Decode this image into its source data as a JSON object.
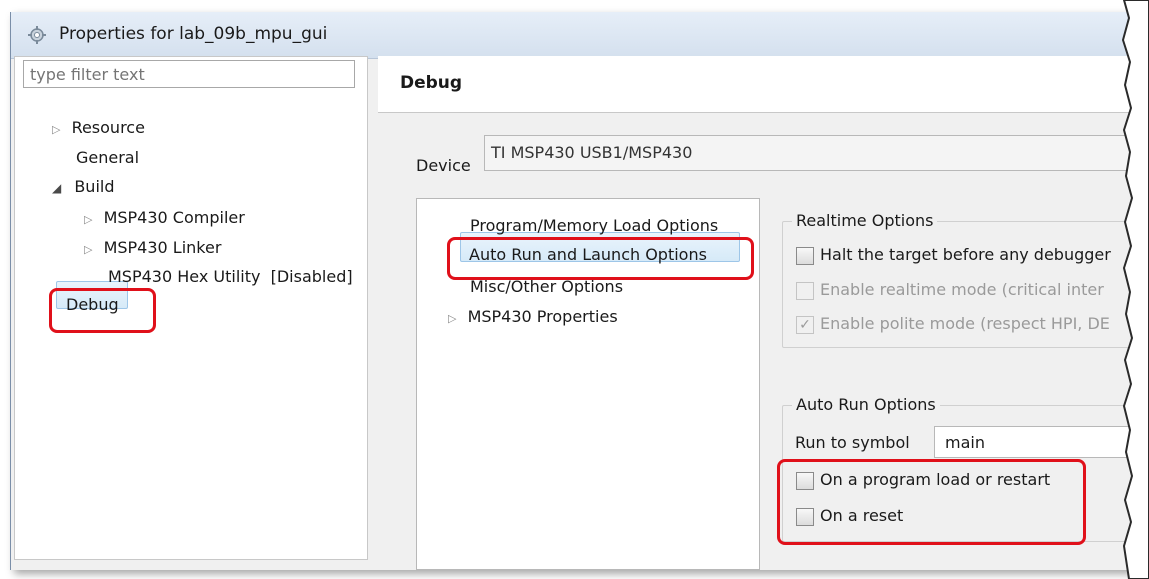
{
  "window": {
    "title": "Properties for lab_09b_mpu_gui"
  },
  "left_pane": {
    "filter_placeholder": "type filter text",
    "tree": [
      {
        "label": "Resource",
        "expander": "▷"
      },
      {
        "label": "General",
        "expander": ""
      },
      {
        "label": "Build",
        "expander": "◢"
      },
      {
        "label": "MSP430 Compiler",
        "expander": "▷"
      },
      {
        "label": "MSP430 Linker",
        "expander": "▷"
      },
      {
        "label": "MSP430 Hex Utility  [Disabled]",
        "expander": ""
      },
      {
        "label": "Debug",
        "expander": "",
        "selected": true
      }
    ]
  },
  "right_pane": {
    "header_title": "Debug",
    "device_label": "Device",
    "device_value": "TI MSP430 USB1/MSP430",
    "options_tree": [
      {
        "label": "Program/Memory Load Options",
        "expander": ""
      },
      {
        "label": "Auto Run and Launch Options",
        "expander": "",
        "selected": true
      },
      {
        "label": "Misc/Other Options",
        "expander": ""
      },
      {
        "label": "MSP430 Properties",
        "expander": "▷"
      }
    ],
    "realtime_group": {
      "title": "Realtime Options",
      "options": [
        {
          "label": "Halt the target before any debugger",
          "checked": false,
          "enabled": true
        },
        {
          "label": "Enable realtime mode (critical inter",
          "checked": false,
          "enabled": false
        },
        {
          "label": "Enable polite mode (respect HPI, DE",
          "checked": true,
          "enabled": false
        }
      ]
    },
    "autorun_group": {
      "title": "Auto Run Options",
      "run_to_symbol_label": "Run to symbol",
      "run_to_symbol_value": "main",
      "options": [
        {
          "label": "On a program load or restart",
          "checked": false
        },
        {
          "label": "On a reset",
          "checked": false
        }
      ]
    }
  },
  "colors": {
    "highlight_box": "#e0101a",
    "selection_fill": "#d6eaf8",
    "window_bg": "#f0f0f0"
  },
  "icons": {
    "title": "gear-icon",
    "collapsed": "triangle-right-icon",
    "expanded": "triangle-down-icon",
    "check": "checkmark-icon"
  }
}
